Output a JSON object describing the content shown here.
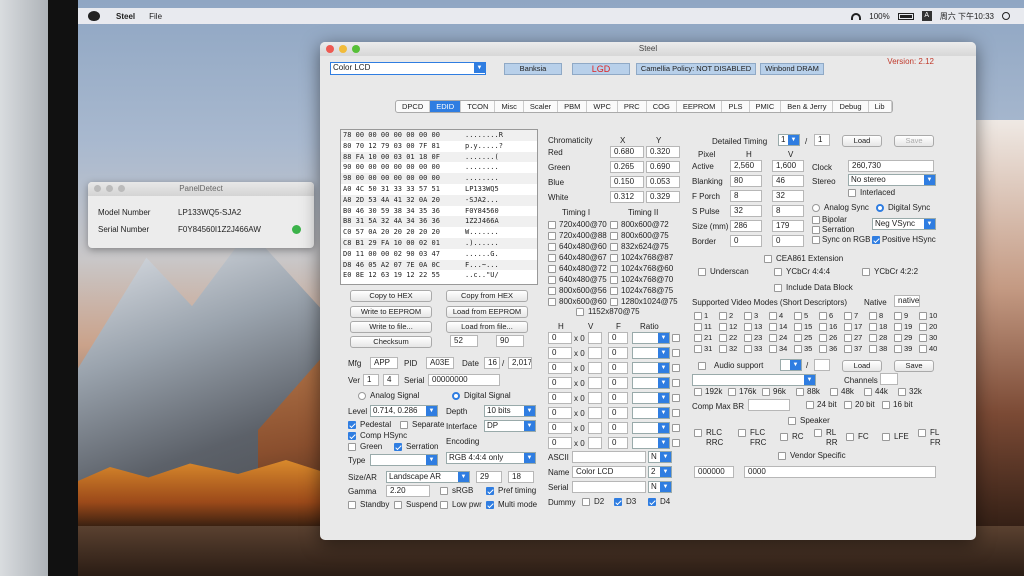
{
  "menubar": {
    "app_name": "Steel",
    "file_menu": "File",
    "battery": "100%",
    "input_badge": "A",
    "clock": "周六 下午10:33"
  },
  "paneldetect": {
    "title": "PanelDetect",
    "model_label": "Model Number",
    "model_value": "LP133WQ5-SJA2",
    "serial_label": "Serial Number",
    "serial_value": "F0Y84560I1Z2J466AW"
  },
  "steel": {
    "title": "Steel",
    "version": "Version: 2.12",
    "display_select": "Color LCD",
    "vendor_pills": [
      "Banksia",
      "LGD",
      "Camellia Policy: NOT DISABLED",
      "Winbond DRAM"
    ],
    "tabs": [
      "DPCD",
      "EDID",
      "TCON",
      "Misc",
      "Scaler",
      "PBM",
      "WPC",
      "PRC",
      "COG",
      "EEPROM",
      "PLS",
      "PMIC",
      "Ben & Jerry",
      "Debug",
      "Lib"
    ],
    "active_tab": "EDID",
    "hex_rows": [
      {
        "h": "78 00 00 00 00 00 00 00",
        "a": "........R"
      },
      {
        "h": "80 70 12 79 03 00 7F 81",
        "a": "p.y.....?"
      },
      {
        "h": "88 FA 10 00 03 01 18 0F",
        "a": ".......("
      },
      {
        "h": "90 00 00 00 00 00 00 00",
        "a": "........"
      },
      {
        "h": "98 00 00 00 00 00 00 00",
        "a": "........"
      },
      {
        "h": "A0 4C 50 31 33 33 57 51",
        "a": "LP133WQ5"
      },
      {
        "h": "A8 2D 53 4A 41 32 0A 20",
        "a": "-SJA2..."
      },
      {
        "h": "B0 46 30 59 38 34 35 36",
        "a": "F0Y84560"
      },
      {
        "h": "B8 31 5A 32 4A 34 36 36",
        "a": "1Z2J466A"
      },
      {
        "h": "C0 57 0A 20 20 20 20 20",
        "a": "W......."
      },
      {
        "h": "C8 B1 29 FA 10 00 02 01",
        "a": ".)......"
      },
      {
        "h": "D0 11 00 00 02 90 03 47",
        "a": "......G."
      },
      {
        "h": "D8 46 05 A2 07 7E 0A 0C",
        "a": "F...~..."
      },
      {
        "h": "E0 8E 12 63 19 12 22 55",
        "a": "..c..\"U/"
      }
    ],
    "buttons": {
      "copy_to_hex": "Copy to HEX",
      "copy_from_hex": "Copy from HEX",
      "write_eeprom": "Write to EEPROM",
      "load_eeprom": "Load from EEPROM",
      "write_file": "Write to file...",
      "load_file": "Load from file...",
      "checksum": "Checksum",
      "checksum_a": "52",
      "checksum_b": "90"
    },
    "mfg": {
      "mfg_label": "Mfg",
      "mfg": "APP",
      "pid_label": "PID",
      "pid": "A03E",
      "date_label": "Date",
      "week": "16",
      "year": "2,017",
      "ver_label": "Ver",
      "ver_major": "1",
      "ver_minor": "4",
      "serial_label": "Serial",
      "serial": "00000000"
    },
    "signal": {
      "analog": "Analog Signal",
      "digital": "Digital Signal",
      "level_label": "Level",
      "level": "0.714, 0.286",
      "depth_label": "Depth",
      "depth": "10 bits",
      "interface_label": "Interface",
      "interface": "DP",
      "encoding_label": "Encoding",
      "encoding": "RGB 4:4:4 only",
      "pedestal": "Pedestal",
      "separate": "Separate",
      "comp_hsync": "Comp HSync",
      "green": "Green",
      "serration": "Serration",
      "type_label": "Type"
    },
    "size": {
      "size_label": "Size/AR",
      "size": "Landscape AR",
      "w": "29",
      "h": "18",
      "gamma_label": "Gamma",
      "gamma": "2.20",
      "srgb": "sRGB",
      "pref_timing": "Pref timing",
      "standby": "Standby",
      "suspend": "Suspend",
      "low_pwr": "Low pwr",
      "multi_mode": "Multi mode"
    },
    "chroma": {
      "title": "Chromaticity",
      "x": "X",
      "y": "Y",
      "rows": [
        {
          "name": "Red",
          "x": "0.680",
          "y": "0.320"
        },
        {
          "name": "Green",
          "x": "0.265",
          "y": "0.690"
        },
        {
          "name": "Blue",
          "x": "0.150",
          "y": "0.053"
        },
        {
          "name": "White",
          "x": "0.312",
          "y": "0.329"
        }
      ]
    },
    "timings1": {
      "title": "Timing I",
      "items": [
        "720x400@70",
        "720x400@88",
        "640x480@60",
        "640x480@67",
        "640x480@72",
        "640x480@75",
        "800x600@56",
        "800x600@60"
      ]
    },
    "timings2": {
      "title": "Timing II",
      "items": [
        "800x600@72",
        "800x600@75",
        "832x624@75",
        "1024x768@87",
        "1024x768@60",
        "1024x768@70",
        "1024x768@75",
        "1280x1024@75"
      ]
    },
    "timing_extra": "1152x870@75",
    "std_headers": {
      "h": "H",
      "v": "V",
      "f": "F",
      "ratio": "Ratio",
      "x": "x 0",
      "zero": "0"
    },
    "ascii": {
      "ascii_label": "ASCII",
      "name_label": "Name",
      "name": "Color LCD",
      "name_n": "2",
      "serial_label": "Serial",
      "n": "N",
      "dummy_label": "Dummy",
      "d2": "D2",
      "d3": "D3",
      "d4": "D4"
    },
    "detailed": {
      "title": "Detailed Timing",
      "index": "1",
      "slash": "/",
      "count": "1",
      "load": "Load",
      "save": "Save",
      "pixel": "Pixel",
      "h": "H",
      "v": "V",
      "active_label": "Active",
      "active_h": "2,560",
      "active_v": "1,600",
      "clock_label": "Clock",
      "clock": "260,730",
      "blanking_label": "Blanking",
      "blank_h": "80",
      "blank_v": "46",
      "stereo_label": "Stereo",
      "stereo": "No stereo",
      "fporch_label": "F Porch",
      "fp_h": "8",
      "fp_v": "32",
      "interlaced": "Interlaced",
      "spulse_label": "S Pulse",
      "sp_h": "32",
      "sp_v": "8",
      "analog_sync": "Analog Sync",
      "digital_sync": "Digital Sync",
      "size_label": "Size (mm)",
      "size_h": "286",
      "size_v": "179",
      "bipolar": "Bipolar",
      "serration": "Serration",
      "vsync": "Neg VSync",
      "border_label": "Border",
      "border_h": "0",
      "border_v": "0",
      "sync_rgb": "Sync on RGB",
      "pos_hsync": "Positive HSync"
    },
    "cea": {
      "ext": "CEA861 Extension",
      "underscan": "Underscan",
      "ycbcr444": "YCbCr 4:4:4",
      "ycbcr422": "YCbCr 4:2:2",
      "data_block": "Include Data Block",
      "svd_title": "Supported Video Modes (Short Descriptors)",
      "native_label": "Native",
      "native": "native",
      "svd_nums": [
        "1",
        "2",
        "3",
        "4",
        "5",
        "6",
        "7",
        "8",
        "9",
        "10",
        "11",
        "12",
        "13",
        "14",
        "15",
        "16",
        "17",
        "18",
        "19",
        "20",
        "21",
        "22",
        "23",
        "24",
        "25",
        "26",
        "27",
        "28",
        "29",
        "30",
        "31",
        "32",
        "33",
        "34",
        "35",
        "36",
        "37",
        "38",
        "39",
        "40"
      ],
      "audio": "Audio support",
      "load": "Load",
      "save": "Save",
      "channels": "Channels",
      "rates": [
        "192k",
        "176k",
        "96k",
        "88k",
        "48k",
        "44k",
        "32k"
      ],
      "comp_max": "Comp Max BR",
      "bits": [
        "24 bit",
        "20 bit",
        "16 bit"
      ],
      "speaker": "Speaker",
      "spk": [
        "RLC",
        "RRC",
        "FLC",
        "FRC",
        "RC",
        "RL",
        "RR",
        "FC",
        "LFE",
        "FL",
        "FR"
      ],
      "vendor": "Vendor Specific",
      "vendor_a": "000000",
      "vendor_b": "0000"
    }
  }
}
